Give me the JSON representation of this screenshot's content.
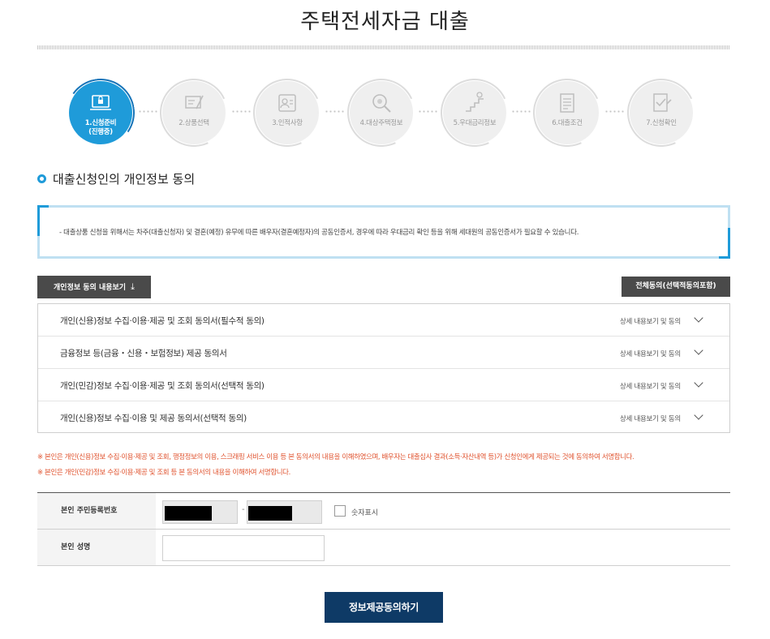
{
  "page": {
    "title": "주택전세자금 대출"
  },
  "stepper": {
    "steps": [
      {
        "label_line1": "1.신청준비",
        "label_line2": "(진행중)",
        "state": "active",
        "icon": "laptop-lock-icon"
      },
      {
        "label_line1": "2.상품선택",
        "label_line2": "",
        "state": "pending",
        "icon": "document-pen-icon"
      },
      {
        "label_line1": "3.인적사항",
        "label_line2": "",
        "state": "pending",
        "icon": "id-card-icon"
      },
      {
        "label_line1": "4.대상주택정보",
        "label_line2": "",
        "state": "pending",
        "icon": "magnifier-icon"
      },
      {
        "label_line1": "5.우대금리정보",
        "label_line2": "",
        "state": "pending",
        "icon": "stairs-icon"
      },
      {
        "label_line1": "6.대출조건",
        "label_line2": "",
        "state": "pending",
        "icon": "list-document-icon"
      },
      {
        "label_line1": "7.신청확인",
        "label_line2": "",
        "state": "pending",
        "icon": "check-document-icon"
      }
    ],
    "active_color": "#1f9bd9"
  },
  "section": {
    "title": "대출신청인의 개인정보 동의"
  },
  "notice": {
    "text": "- 대출상품 신청을 위해서는 차주(대출신청자) 및 결혼(예정) 유무에 따른 배우자(결혼예정자)의 공동인증서, 경우에 따라 우대금리 확인 등을 위해 세대원의 공동인증서가 필요할 수 있습니다."
  },
  "buttons": {
    "view_consent": "개인정보 동의 내용보기",
    "agree_all": "전체동의(선택적동의포함)",
    "submit": "정보제공동의하기"
  },
  "consents": [
    {
      "title": "개인(신용)정보 수집·이용·제공 및 조회 동의서(필수적 동의)",
      "detail": "상세 내용보기 및 동의"
    },
    {
      "title": "금융정보 등(금융・신용・보험정보) 제공 동의서",
      "detail": "상세 내용보기 및 동의"
    },
    {
      "title": "개인(민감)정보 수집·이용·제공 및 조회 동의서(선택적 동의)",
      "detail": "상세 내용보기 및 동의"
    },
    {
      "title": "개인(신용)정보 수집·이용 및 제공 동의서(선택적 동의)",
      "detail": "상세 내용보기 및 동의"
    }
  ],
  "warnings": [
    "※ 본인은 개인(신용)정보 수집·이용·제공 및 조회, 행정정보의 이용, 스크래핑 서비스 이용 등 본 동의서의 내용을 이해하였으며, 배우자는 대출심사 결과(소득·자산내역 등)가 신청인에게 제공되는 것에 동의하여 서명합니다.",
    "※ 본인은 개인(민감)정보 수집·이용·제공 및 조회 등 본 동의서의 내용을 이해하여 서명합니다."
  ],
  "form": {
    "rrn_label": "본인 주민등록번호",
    "rrn_separator": "-",
    "show_digits_label": "숫자표시",
    "name_label": "본인 성명",
    "name_value": ""
  }
}
